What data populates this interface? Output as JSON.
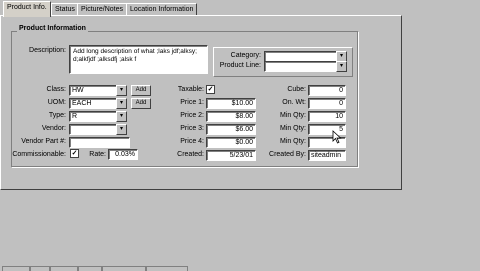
{
  "tabs": [
    {
      "label": "Product Info."
    },
    {
      "label": "Status"
    },
    {
      "label": "Picture/Notes"
    },
    {
      "label": "Location Information"
    }
  ],
  "group_title": "Product Information",
  "description": {
    "label": "Description:",
    "value": "Add long description of what ;laks jdf;alksy; d;alkfjdf ;alksdfj ;alsk f"
  },
  "category": {
    "label": "Category:",
    "value": ""
  },
  "product_line": {
    "label": "Product Line:",
    "value": ""
  },
  "left_fields": {
    "class": {
      "label": "Class:",
      "value": "HW",
      "add": "Add"
    },
    "uom": {
      "label": "UOM:",
      "value": "EACH",
      "add": "Add"
    },
    "type": {
      "label": "Type:",
      "value": "R"
    },
    "vendor": {
      "label": "Vendor:",
      "value": ""
    },
    "vendor_part": {
      "label": "Vendor Part #:",
      "value": ""
    },
    "commissionable": {
      "label": "Commissionable:",
      "checked": "✓"
    },
    "rate": {
      "label": "Rate:",
      "value": "0.03%"
    }
  },
  "mid_fields": {
    "taxable": {
      "label": "Taxable:",
      "checked": "✓"
    },
    "price1": {
      "label": "Price 1:",
      "value": "$10.00"
    },
    "price2": {
      "label": "Price 2:",
      "value": "$8.00"
    },
    "price3": {
      "label": "Price 3:",
      "value": "$6.00"
    },
    "price4": {
      "label": "Price 4:",
      "value": "$0.00"
    },
    "created": {
      "label": "Created:",
      "value": "5/23/01"
    }
  },
  "right_fields": {
    "cube": {
      "label": "Cube:",
      "value": "0"
    },
    "on_wt": {
      "label": "On. Wt:",
      "value": "0"
    },
    "min_qty1": {
      "label": "Min Qty:",
      "value": "10"
    },
    "min_qty2": {
      "label": "Min Qty:",
      "value": "5"
    },
    "min_qty3": {
      "label": "Min Qty:",
      "value": ""
    },
    "created_by": {
      "label": "Created By:",
      "value": "siteadmin"
    }
  },
  "icons": {
    "dropdown": "▾",
    "cursor": "pointer-cursor-icon"
  }
}
